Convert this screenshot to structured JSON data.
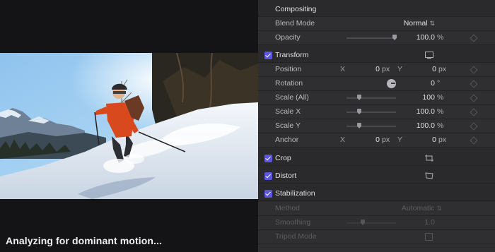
{
  "viewer": {
    "status": "Analyzing for dominant motion..."
  },
  "inspector": {
    "compositing": {
      "title": "Compositing",
      "blend_mode_label": "Blend Mode",
      "blend_mode_value": "Normal",
      "opacity_label": "Opacity",
      "opacity_value": "100.0",
      "opacity_unit": "%",
      "opacity_fraction": 1.0
    },
    "transform": {
      "title": "Transform",
      "position_label": "Position",
      "position_x_axis": "X",
      "position_x_value": "0",
      "position_x_unit": "px",
      "position_y_axis": "Y",
      "position_y_value": "0",
      "position_y_unit": "px",
      "rotation_label": "Rotation",
      "rotation_value": "0",
      "rotation_unit": "°",
      "scale_all_label": "Scale (All)",
      "scale_all_value": "100",
      "scale_all_unit": "%",
      "scale_x_label": "Scale X",
      "scale_x_value": "100.0",
      "scale_x_unit": "%",
      "scale_y_label": "Scale Y",
      "scale_y_value": "100.0",
      "scale_y_unit": "%",
      "anchor_label": "Anchor",
      "anchor_x_axis": "X",
      "anchor_x_value": "0",
      "anchor_x_unit": "px",
      "anchor_y_axis": "Y",
      "anchor_y_value": "0",
      "anchor_y_unit": "px"
    },
    "crop": {
      "title": "Crop"
    },
    "distort": {
      "title": "Distort"
    },
    "stabilization": {
      "title": "Stabilization",
      "method_label": "Method",
      "method_value": "Automatic",
      "smoothing_label": "Smoothing",
      "smoothing_value": "1.0",
      "tripod_label": "Tripod Mode"
    },
    "accent_color": "#5a56e0"
  }
}
